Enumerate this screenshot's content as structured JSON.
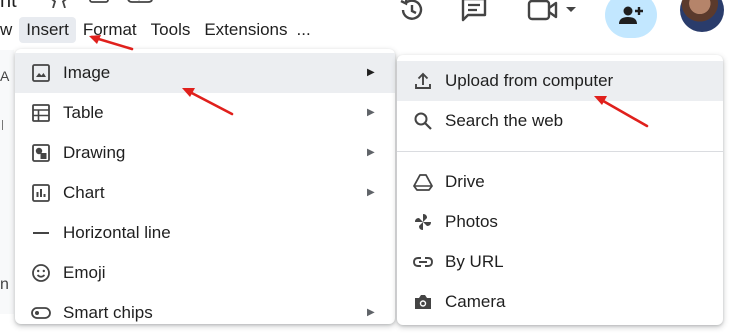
{
  "doc": {
    "title_fragment": "nt"
  },
  "menubar": {
    "items": [
      {
        "label": "w"
      },
      {
        "label": "Insert"
      },
      {
        "label": "Format"
      },
      {
        "label": "Tools"
      },
      {
        "label": "Extensions"
      },
      {
        "label": "..."
      }
    ]
  },
  "left_edge": {
    "glyph_top": "A",
    "glyph_bottom": "n"
  },
  "insert_menu": {
    "items": [
      {
        "label": "Image",
        "icon": "image-icon"
      },
      {
        "label": "Table",
        "icon": "table-icon"
      },
      {
        "label": "Drawing",
        "icon": "drawing-icon"
      },
      {
        "label": "Chart",
        "icon": "chart-icon"
      },
      {
        "label": "Horizontal line",
        "icon": "horizontal-line-icon"
      },
      {
        "label": "Emoji",
        "icon": "emoji-icon"
      },
      {
        "label": "Smart chips",
        "icon": "smart-chips-icon"
      }
    ]
  },
  "image_submenu": {
    "items": [
      {
        "label": "Upload from computer",
        "icon": "upload-icon"
      },
      {
        "label": "Search the web",
        "icon": "search-icon"
      },
      {
        "label": "Drive",
        "icon": "drive-icon"
      },
      {
        "label": "Photos",
        "icon": "photos-icon"
      },
      {
        "label": "By URL",
        "icon": "link-icon"
      },
      {
        "label": "Camera",
        "icon": "camera-icon"
      }
    ]
  },
  "colors": {
    "share_button_bg": "#c2e7ff",
    "annotation_arrow": "#e0201c",
    "highlight_bg": "#eceef1"
  }
}
